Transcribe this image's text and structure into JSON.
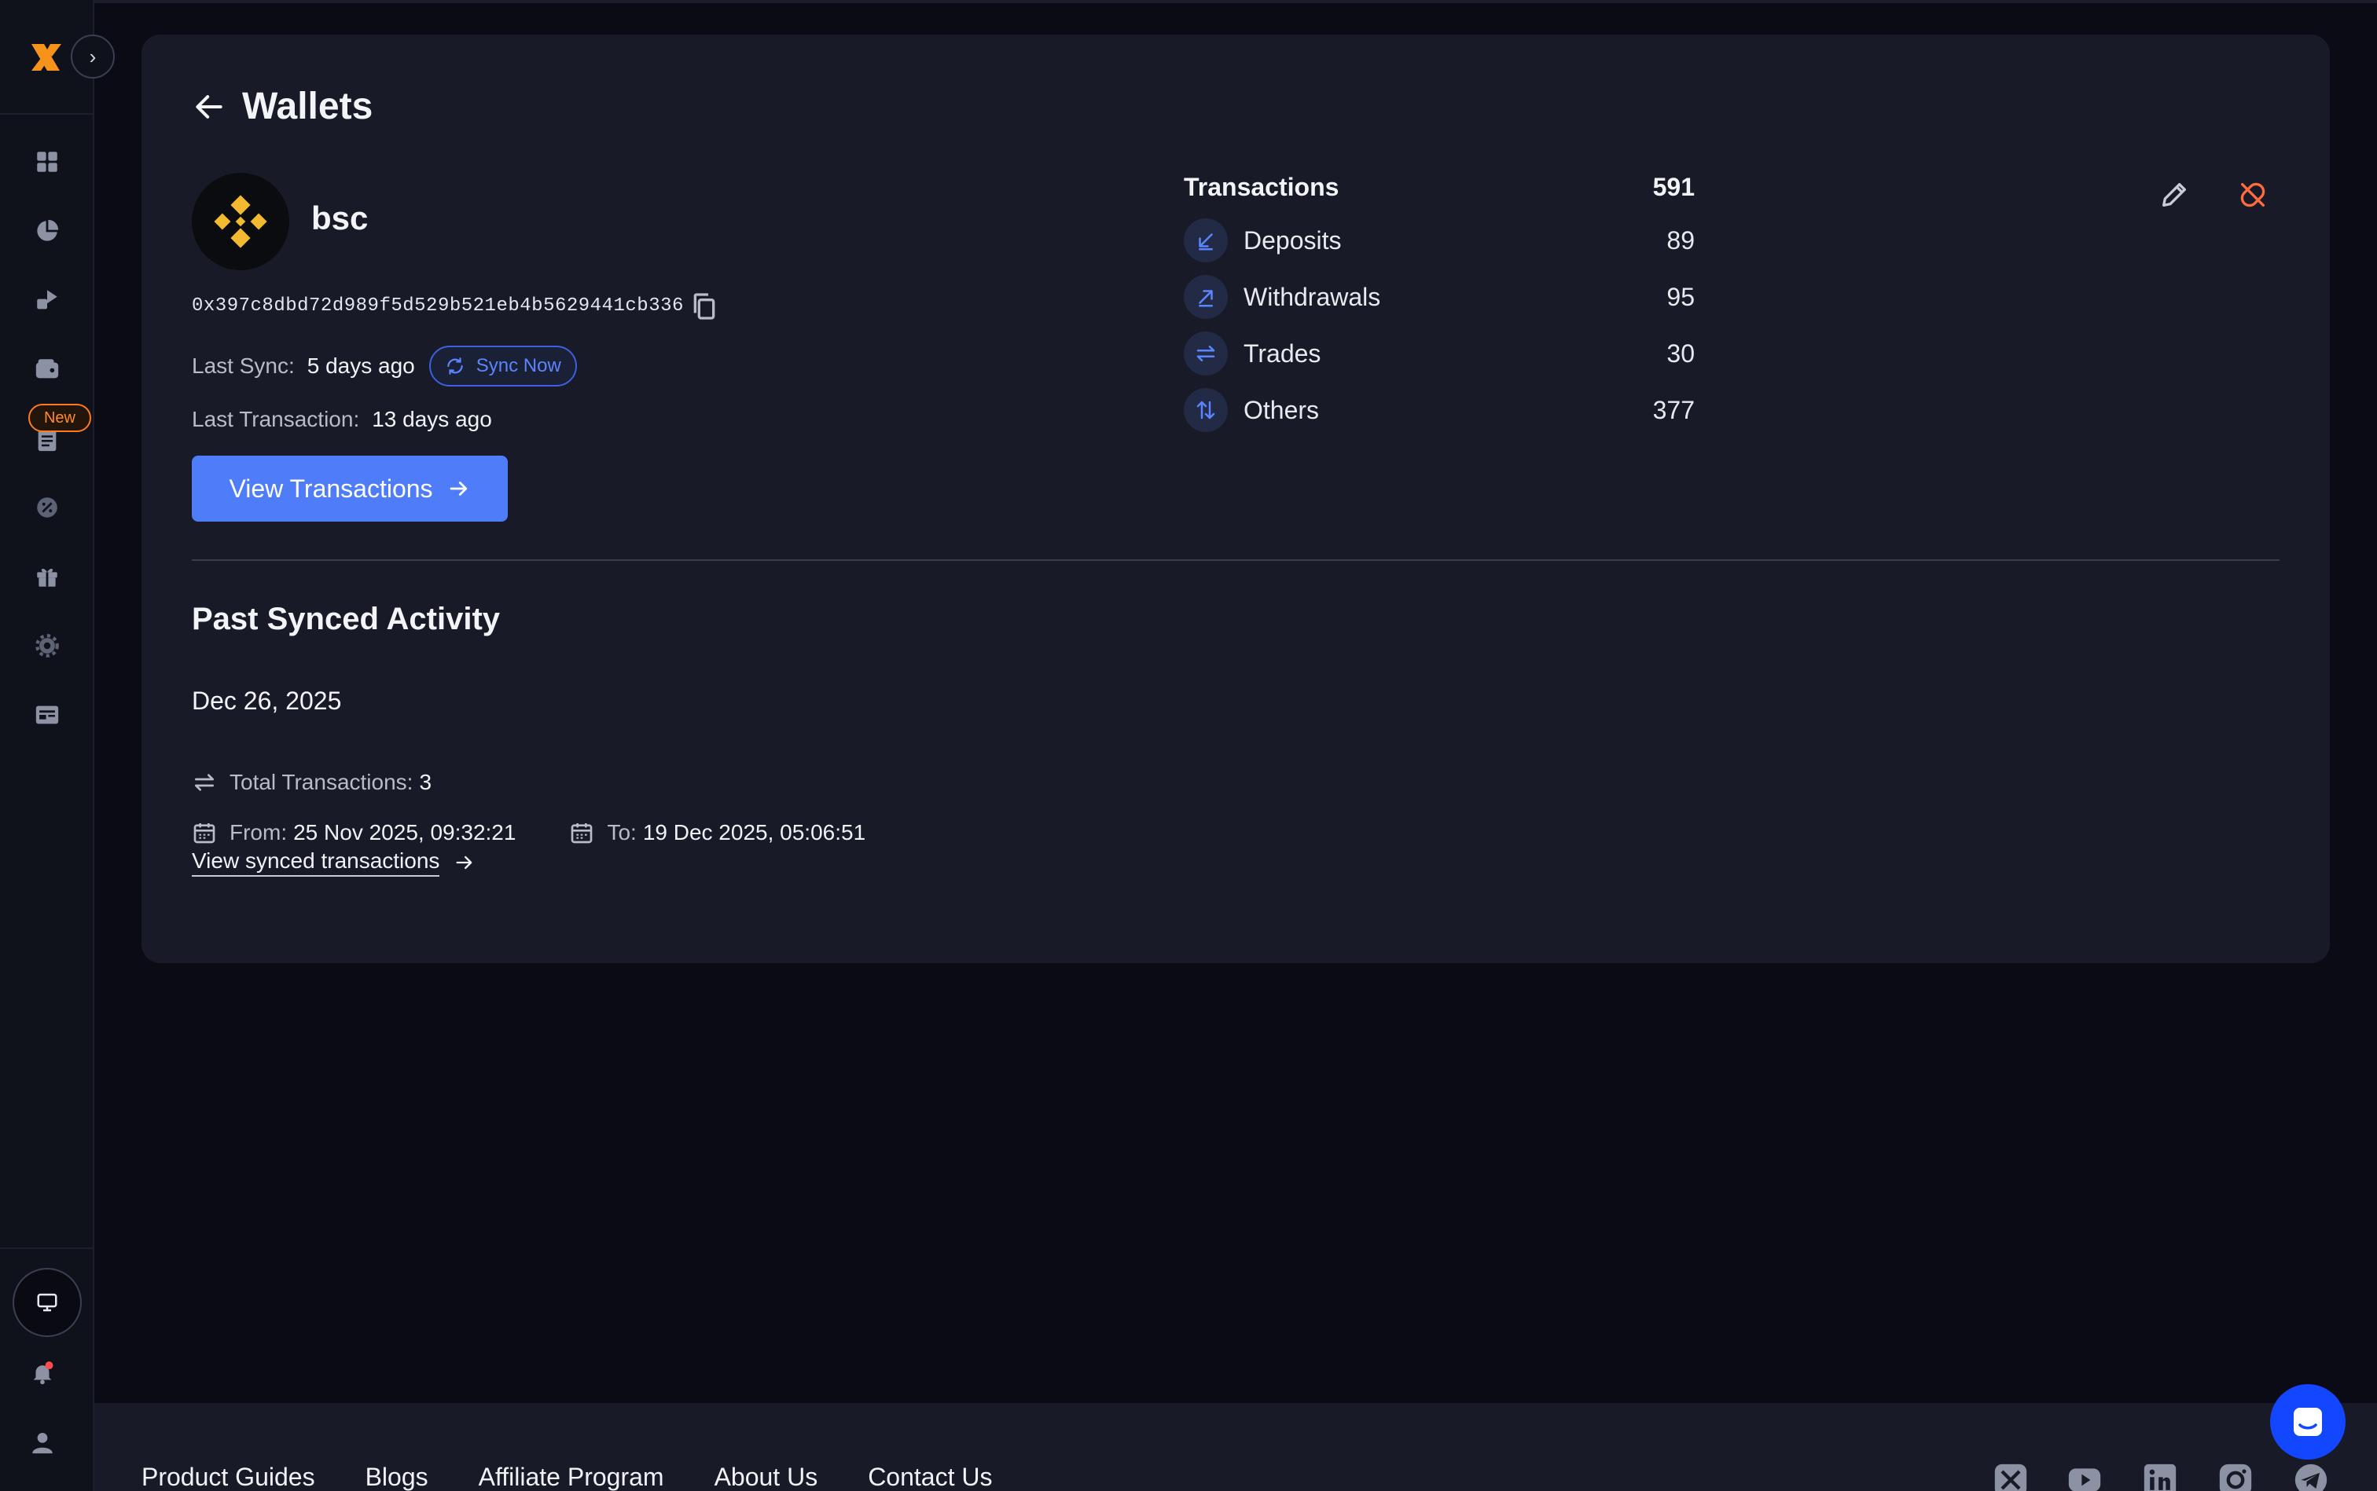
{
  "sidebar": {
    "new_badge": "New",
    "icons": [
      "dashboard-icon",
      "portfolio-icon",
      "transactions-icon",
      "wallet-icon",
      "reports-icon",
      "tax-icon",
      "gift-icon",
      "settings-icon",
      "billing-icon"
    ]
  },
  "page": {
    "title": "Wallets"
  },
  "wallet": {
    "name": "bsc",
    "address": "0x397c8dbd72d989f5d529b521eb4b5629441cb336",
    "last_sync_label": "Last Sync:",
    "last_sync_value": "5 days ago",
    "sync_now": "Sync Now",
    "last_tx_label": "Last Transaction:",
    "last_tx_value": "13 days ago",
    "view_transactions": "View Transactions"
  },
  "transactions": {
    "label": "Transactions",
    "total": "591",
    "rows": [
      {
        "label": "Deposits",
        "value": "89"
      },
      {
        "label": "Withdrawals",
        "value": "95"
      },
      {
        "label": "Trades",
        "value": "30"
      },
      {
        "label": "Others",
        "value": "377"
      }
    ]
  },
  "activity": {
    "title": "Past Synced Activity",
    "date": "Dec 26, 2025",
    "total_label": "Total Transactions:",
    "total_value": "3",
    "from_label": "From:",
    "from_value": "25 Nov 2025, 09:32:21",
    "to_label": "To:",
    "to_value": "19 Dec 2025, 05:06:51",
    "link": "View synced transactions"
  },
  "footer": {
    "links": [
      "Product Guides",
      "Blogs",
      "Affiliate Program",
      "About Us",
      "Contact Us"
    ]
  },
  "colors": {
    "accent": "#4f7df9",
    "brand_orange": "#f7931a",
    "binance_yellow": "#f3ba2f",
    "unlink_red": "#ff6b3d",
    "card_bg": "#181b27",
    "page_bg": "#0a0b14"
  }
}
